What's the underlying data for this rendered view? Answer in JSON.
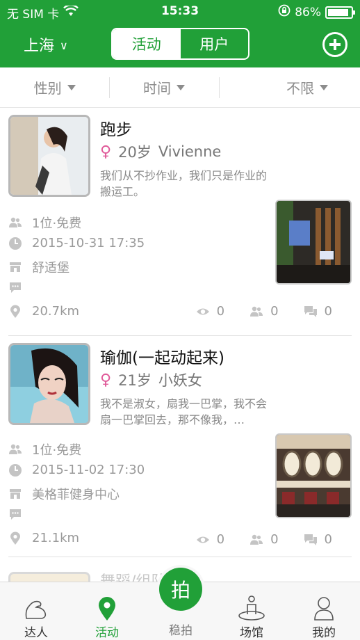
{
  "status_bar": {
    "carrier": "无 SIM 卡",
    "time": "15:33",
    "battery": "86%"
  },
  "nav": {
    "city": "上海",
    "tabs": [
      "活动",
      "用户"
    ],
    "active_tab": "活动",
    "add_icon": "plus-circle-icon"
  },
  "filters": [
    "性别",
    "时间",
    "不限"
  ],
  "feed": [
    {
      "title": "跑步",
      "gender_icon": "female-icon",
      "age": "20岁",
      "name": "Vivienne",
      "desc": "我们从不抄作业，我们只是作业的搬运工。",
      "people": "1位·免费",
      "datetime": "2015-10-31 17:35",
      "venue": "舒适堡",
      "distance": "20.7km",
      "views": "0",
      "joins": "0",
      "comments": "0"
    },
    {
      "title": "瑜伽(一起动起来)",
      "gender_icon": "female-icon",
      "age": "21岁",
      "name": "小妖女",
      "desc": "我不是淑女，扇我一巴掌，我不会扇一巴掌回去，那不像我，…",
      "people": "1位·免费",
      "datetime": "2015-11-02 17:30",
      "venue": "美格菲健身中心",
      "distance": "21.1km",
      "views": "0",
      "joins": "0",
      "comments": "0"
    }
  ],
  "peek_title": "舞蹈/组队",
  "tabbar": {
    "items": [
      "达人",
      "活动",
      "稳拍",
      "场馆",
      "我的"
    ],
    "center_button": "拍",
    "active": "活动"
  }
}
